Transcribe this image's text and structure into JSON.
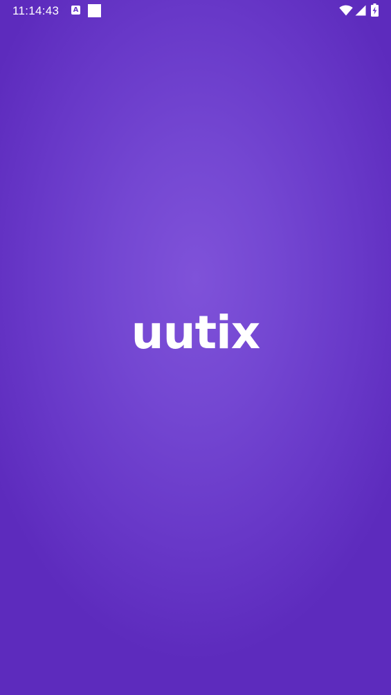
{
  "status_bar": {
    "time": "11:14:43",
    "notification_letter": "A",
    "icons": [
      "a-notification-icon",
      "square-notification-icon",
      "wifi-icon",
      "cell-signal-icon",
      "battery-charging-icon"
    ]
  },
  "splash": {
    "logo_text": "uutix"
  },
  "colors": {
    "background_center": "#7f52d9",
    "background_edge": "#5d2bbd",
    "foreground": "#ffffff"
  }
}
